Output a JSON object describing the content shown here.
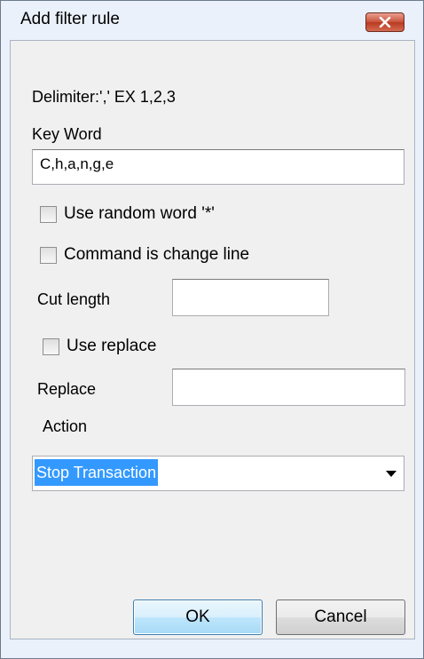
{
  "window": {
    "title": "Add filter rule"
  },
  "form": {
    "delimiter_hint": "Delimiter:',' EX 1,2,3",
    "keyword_label": "Key Word",
    "keyword_value": "C,h,a,n,g,e",
    "use_random_word_label": "Use random word '*'",
    "use_random_word_checked": false,
    "command_change_line_label": "Command is change line",
    "command_change_line_checked": false,
    "cut_length_label": "Cut length",
    "cut_length_value": "",
    "use_replace_label": "Use replace",
    "use_replace_checked": false,
    "replace_label": "Replace",
    "replace_value": "",
    "action_label": "Action",
    "action_selected": "Stop Transaction"
  },
  "buttons": {
    "ok_label": "OK",
    "cancel_label": "Cancel"
  },
  "colors": {
    "selection": "#3399ff",
    "close_button": "#c8513a",
    "window_frame": "#eaf1fb"
  },
  "icons": {
    "close": "close-x-icon",
    "dropdown": "chevron-down-icon"
  }
}
